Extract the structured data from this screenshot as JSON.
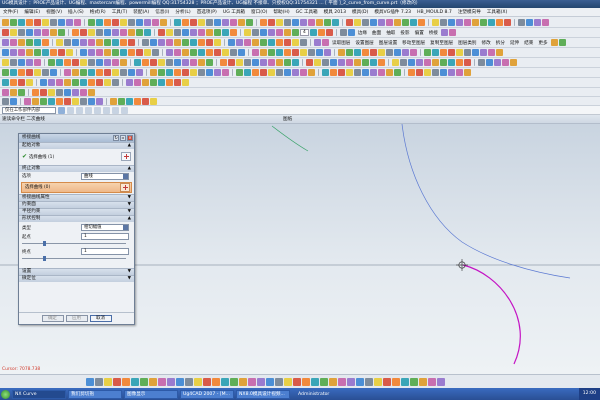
{
  "window": {
    "title": "UG模具设计 ：PROE产品设计、UG编程、mastercam编程、powermill编程 QQ:31754328 ；PROE产品设计、UG编程 不接单、只授权QQ:31754321   ...    [ 平面 ]_2_curve_from_curve.prt（修改的）"
  },
  "menubar": {
    "items": [
      "文件(F)",
      "编辑(E)",
      "视图(V)",
      "插入(S)",
      "格式(R)",
      "工具(T)",
      "装配(A)",
      "信息(I)",
      "分析(L)",
      "首选项(P)",
      "UG 工具箱",
      "窗口(O)",
      "帮助(H)",
      "GC 工具箱",
      "模具 2013",
      "模具(D)",
      "模具VG插件 7.23",
      "HB_MOULD 8.7",
      "注塑模向导",
      "工具箱(X)"
    ]
  },
  "toolbar": {
    "select_value": "4",
    "right_labels": [
      "边缘",
      "曲面",
      "抽取",
      "投影",
      "偏置",
      "桥接",
      "通用",
      "延伸",
      "修剪",
      "拉伸",
      "修改"
    ],
    "row3_labels": [
      "读取图层",
      "设置图层",
      "图层设置",
      "移动至图层",
      "复制至图层",
      "图层类别",
      "修改",
      "拆分",
      "延伸",
      "结束",
      "更多"
    ]
  },
  "commandbar": {
    "filter_value": "仅在工作部件内部"
  },
  "viewbar": {
    "breadcrumb": "速读命令栏 二次曲线",
    "view_title": "图纸"
  },
  "canvas": {
    "csys_label": "Cursor: 7078.738",
    "curve_colors": {
      "green": "#3aa36a",
      "blue": "#5b79d2",
      "magenta": "#c414c4",
      "guide": "#6b7a8c"
    }
  },
  "dialog": {
    "title": "桥接曲线",
    "sections": {
      "start_object": "起始对象",
      "end_object": "终止对象",
      "bridge_props": "桥接曲线属性",
      "constraint": "约束面",
      "radius": "半径约束",
      "shape": "形状控制",
      "settings": "设置",
      "preview": "微定位"
    },
    "start_select_label": "选择曲线 (1)",
    "end_option_label": "选项",
    "end_option_value": "曲线",
    "end_select_label": "选择曲线 (0)",
    "method_label": "类型",
    "method_value": "相切幅值",
    "start_label": "起点",
    "start_value": "1",
    "end_label": "终点",
    "end_value": "1",
    "buttons": {
      "ok": "确定",
      "apply": "应用",
      "cancel": "取消"
    }
  },
  "taskbar": {
    "tasks": [
      "NX Curve",
      "我们剪切抱",
      "图像显示",
      "Ug4CAD 2007 - [M...",
      "NX8.0模具设计视频..."
    ],
    "user": "Administrator",
    "clock": "12:00"
  }
}
